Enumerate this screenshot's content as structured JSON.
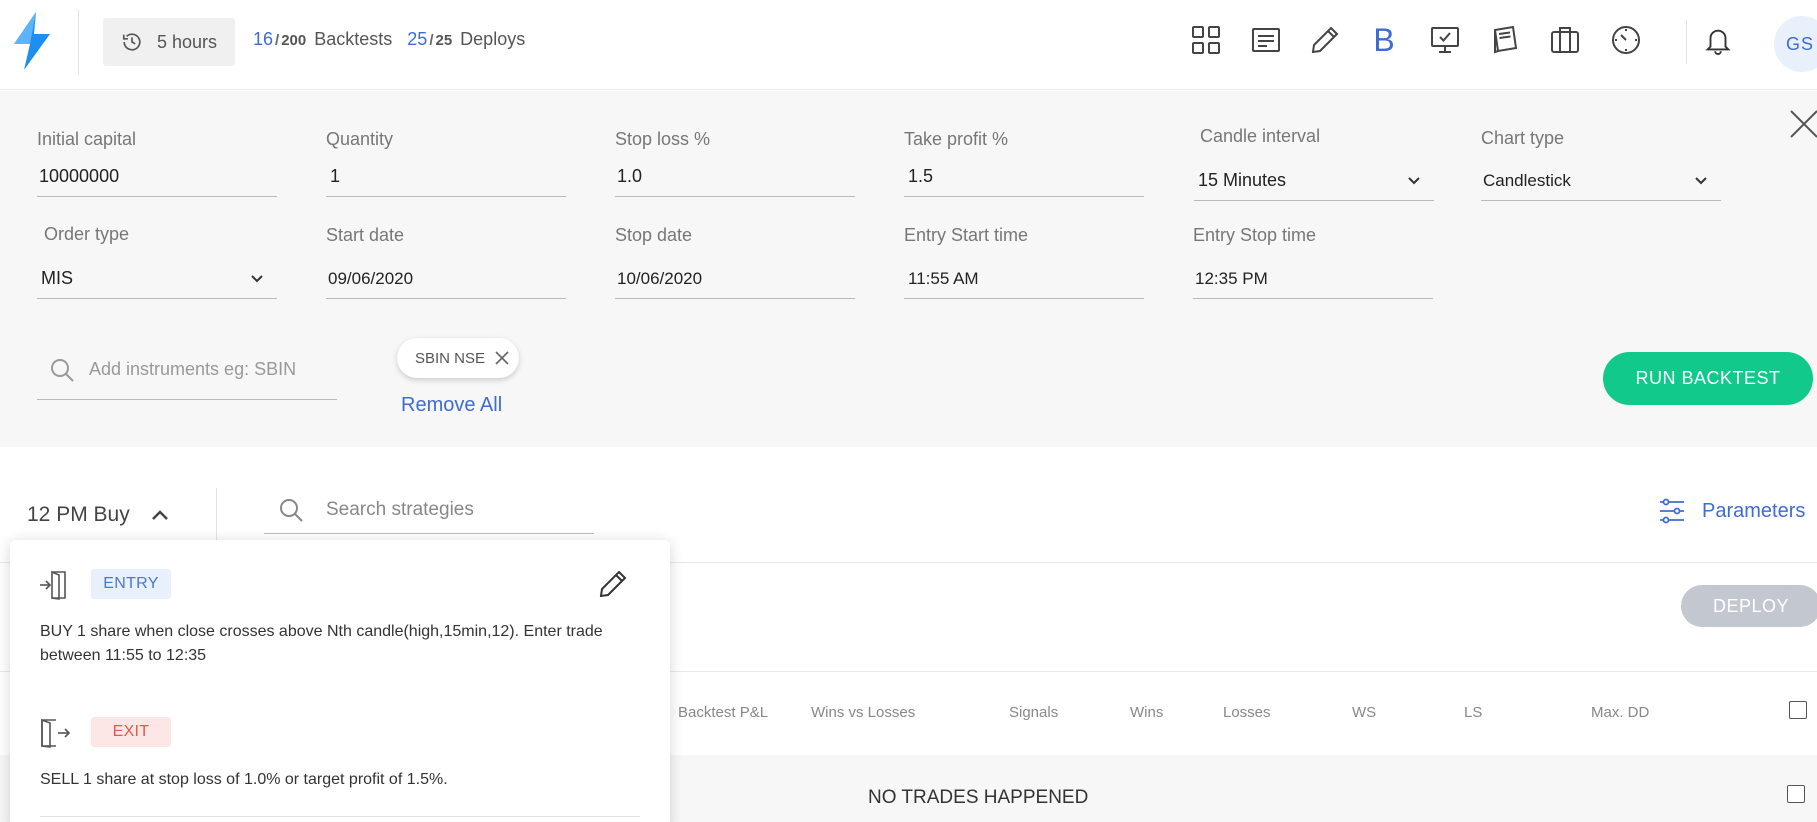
{
  "topbar": {
    "session": "5 hours",
    "backtests_used": "16",
    "backtests_cap": "200",
    "backtests_label": "Backtests",
    "deploys_used": "25",
    "deploys_cap": "25",
    "deploys_label": "Deploys",
    "separator": "/",
    "brand_letter": "B",
    "avatar": "GS",
    "icons": [
      "grid-icon",
      "list-icon",
      "pencil-icon",
      "b-icon",
      "monitor-check-icon",
      "book-icon",
      "briefcase-icon",
      "clock-icon",
      "bell-icon"
    ]
  },
  "params": {
    "initial_capital": {
      "label": "Initial capital",
      "value": "10000000"
    },
    "quantity": {
      "label": "Quantity",
      "value": "1"
    },
    "stop_loss": {
      "label": "Stop loss %",
      "value": "1.0"
    },
    "take_profit": {
      "label": "Take profit %",
      "value": "1.5"
    },
    "candle_interval": {
      "label": "Candle interval",
      "value": "15 Minutes"
    },
    "chart_type": {
      "label": "Chart type",
      "value": "Candlestick"
    },
    "order_type": {
      "label": "Order type",
      "value": "MIS"
    },
    "start_date": {
      "label": "Start date",
      "value": "09/06/2020"
    },
    "stop_date": {
      "label": "Stop date",
      "value": "10/06/2020"
    },
    "entry_start": {
      "label": "Entry Start time",
      "value": "11:55 AM"
    },
    "entry_stop": {
      "label": "Entry Stop time",
      "value": "12:35 PM"
    },
    "instrument_placeholder": "Add instruments eg: SBIN",
    "instrument_chip": "SBIN NSE",
    "remove_all": "Remove All",
    "run_button": "RUN BACKTEST"
  },
  "strategy": {
    "name": "12 PM Buy",
    "search_placeholder": "Search strategies",
    "parameters_link": "Parameters",
    "deploy_button": "DEPLOY"
  },
  "table": {
    "headers": [
      "Backtest P&L",
      "Wins vs Losses",
      "Signals",
      "Wins",
      "Losses",
      "WS",
      "LS",
      "Max. DD"
    ],
    "empty_message": "NO TRADES HAPPENED"
  },
  "popup": {
    "entry_badge": "ENTRY",
    "entry_text": "BUY 1 share when close crosses above Nth candle(high,15min,12). Enter trade between 11:55 to 12:35",
    "exit_badge": "EXIT",
    "exit_text": "SELL 1 share at stop loss of 1.0% or target profit of 1.5%."
  },
  "colors": {
    "accent": "#3f6bd6",
    "run_button": "#11c98a",
    "deploy_disabled": "#c3c8d0",
    "entry_badge_bg": "#e7f0fb",
    "exit_badge_bg": "#fde6e6",
    "logo": "#1e8ff0"
  }
}
